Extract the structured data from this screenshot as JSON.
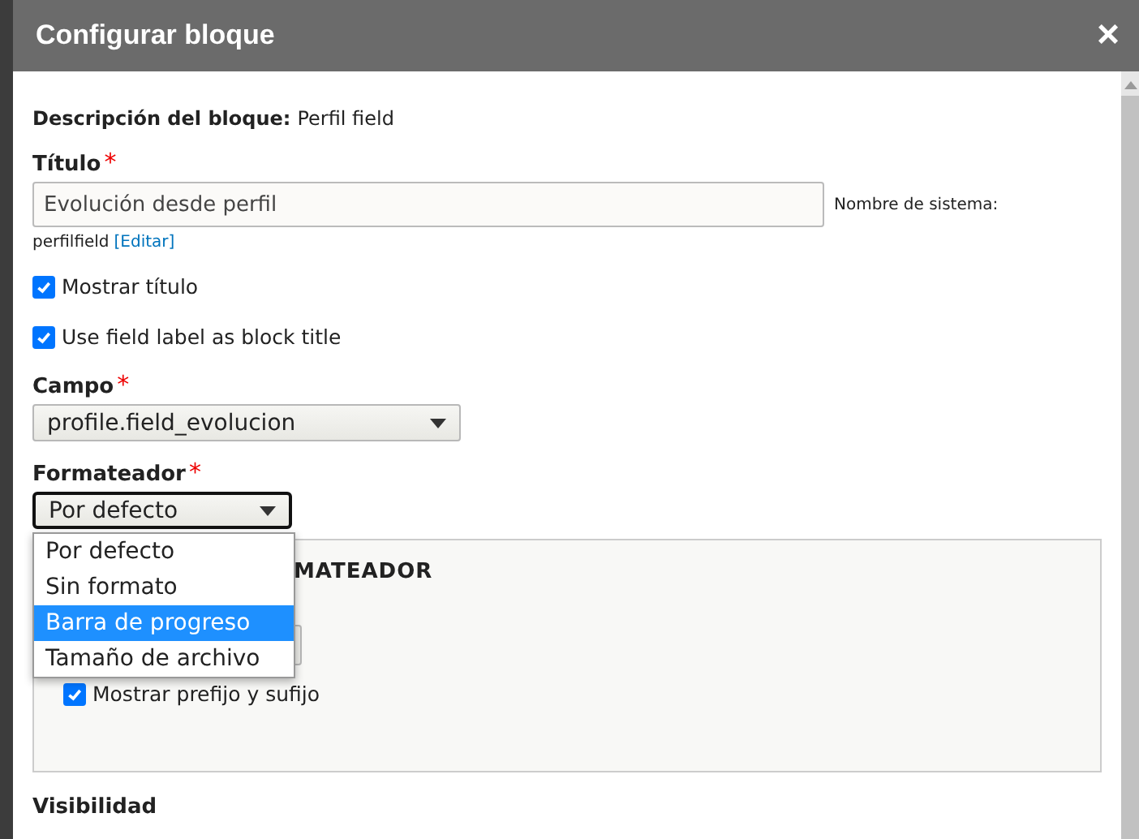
{
  "dialog": {
    "title": "Configurar bloque",
    "close": "×"
  },
  "description": {
    "label": "Descripción del bloque:",
    "value": "Perfil field"
  },
  "title_field": {
    "label": "Título",
    "required_mark": "*",
    "value": "Evolución desde perfil",
    "machine_label": "Nombre de sistema:",
    "machine_name": "perfilfield",
    "edit_link": "[Editar]"
  },
  "checkboxes": [
    {
      "label": "Mostrar título",
      "checked": true
    },
    {
      "label": "Use field label as block title",
      "checked": true
    }
  ],
  "field_select": {
    "label": "Campo",
    "required_mark": "*",
    "value": "profile.field_evolucion"
  },
  "formatter_select": {
    "label": "Formateador",
    "required_mark": "*",
    "value": "Por defecto",
    "expanded": true,
    "options": [
      {
        "label": "Por defecto",
        "highlighted": false
      },
      {
        "label": "Sin formato",
        "highlighted": false
      },
      {
        "label": "Barra de progreso",
        "highlighted": true
      },
      {
        "label": "Tamaño de archivo",
        "highlighted": false
      }
    ]
  },
  "formatter_settings": {
    "legend": "MATEADOR",
    "checkbox": {
      "label": "Mostrar prefijo y sufijo",
      "checked": true
    }
  },
  "next_section": {
    "label": "Visibilidad"
  }
}
